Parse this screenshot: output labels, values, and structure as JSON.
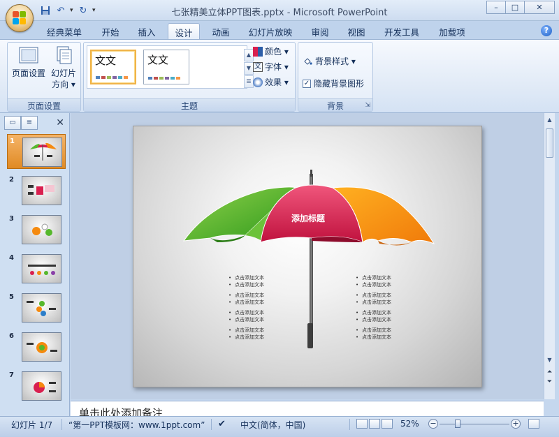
{
  "window": {
    "title": "七张精美立体PPT图表.pptx - Microsoft PowerPoint",
    "controls": {
      "minimize": "–",
      "maximize": "□",
      "close": "✕"
    }
  },
  "quick_access": {
    "save_icon": "save-icon",
    "undo_icon": "undo-icon",
    "redo_icon": "redo-icon"
  },
  "tabs": [
    {
      "label": "经典菜单",
      "active": false
    },
    {
      "label": "开始",
      "active": false
    },
    {
      "label": "插入",
      "active": false
    },
    {
      "label": "设计",
      "active": true
    },
    {
      "label": "动画",
      "active": false
    },
    {
      "label": "幻灯片放映",
      "active": false
    },
    {
      "label": "审阅",
      "active": false
    },
    {
      "label": "视图",
      "active": false
    },
    {
      "label": "开发工具",
      "active": false
    },
    {
      "label": "加载项",
      "active": false
    }
  ],
  "ribbon": {
    "page_setup": {
      "label": "页面设置",
      "page_setup_btn": "页面设置",
      "orientation_btn_line1": "幻灯片",
      "orientation_btn_line2": "方向 ▾"
    },
    "themes": {
      "label": "主题",
      "thumb1": "文文",
      "thumb2": "文文",
      "colors": "颜色 ▾",
      "fonts": "字体 ▾",
      "effects": "效果 ▾"
    },
    "background": {
      "label": "背景",
      "styles": "背景样式 ▾",
      "hide_graphics": "隐藏背景图形",
      "hide_graphics_checked": true
    }
  },
  "slides_pane": {
    "thumbnails": [
      "1",
      "2",
      "3",
      "4",
      "5",
      "6",
      "7"
    ],
    "active_index": 0
  },
  "slide": {
    "title": "添加标题",
    "left_bullets": [
      [
        "点击添加文本",
        "点击添加文本"
      ],
      [
        "点击添加文本",
        "点击添加文本"
      ],
      [
        "点击添加文本",
        "点击添加文本"
      ],
      [
        "点击添加文本",
        "点击添加文本"
      ]
    ],
    "right_bullets": [
      [
        "点击添加文本",
        "点击添加文本"
      ],
      [
        "点击添加文本",
        "点击添加文本"
      ],
      [
        "点击添加文本",
        "点击添加文本"
      ],
      [
        "点击添加文本",
        "点击添加文本"
      ]
    ],
    "colors": {
      "green": "#56b82c",
      "crimson": "#d9204f",
      "orange": "#f58a0f",
      "shaft": "#555555"
    }
  },
  "notes": {
    "placeholder": "单击此处添加备注"
  },
  "status_bar": {
    "slide_info": "幻灯片 1/7",
    "theme": "“第一PPT模板网：www.1ppt.com”",
    "language": "中文(简体，中国)",
    "zoom": "52%"
  }
}
